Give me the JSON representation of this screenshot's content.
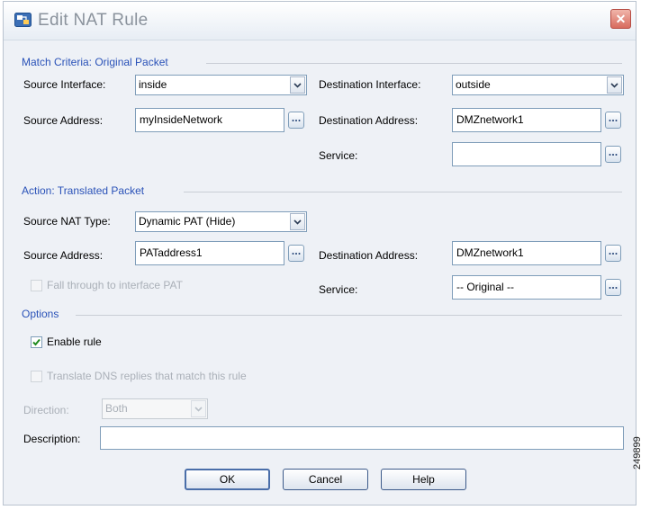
{
  "window": {
    "title": "Edit NAT Rule"
  },
  "match_section": {
    "title": "Match Criteria: Original Packet",
    "source_interface_label": "Source Interface:",
    "source_interface_value": "inside",
    "destination_interface_label": "Destination Interface:",
    "destination_interface_value": "outside",
    "source_address_label": "Source Address:",
    "source_address_value": "myInsideNetwork",
    "destination_address_label": "Destination Address:",
    "destination_address_value": "DMZnetwork1",
    "service_label": "Service:",
    "service_value": ""
  },
  "action_section": {
    "title": "Action: Translated Packet",
    "nat_type_label": "Source NAT Type:",
    "nat_type_value": "Dynamic PAT (Hide)",
    "source_address_label": "Source Address:",
    "source_address_value": "PATaddress1",
    "destination_address_label": "Destination Address:",
    "destination_address_value": "DMZnetwork1",
    "fall_through_label": "Fall through to interface PAT",
    "service_label": "Service:",
    "service_value": "-- Original --"
  },
  "options_section": {
    "title": "Options",
    "enable_rule_label": "Enable rule",
    "enable_rule_checked": true,
    "translate_dns_label": "Translate DNS replies that match this rule",
    "direction_label": "Direction:",
    "direction_value": "Both",
    "description_label": "Description:",
    "description_value": ""
  },
  "buttons": {
    "ok": "OK",
    "cancel": "Cancel",
    "help": "Help"
  },
  "figure_id": "249899",
  "icons": {
    "app": "app-icon",
    "close": "close-icon",
    "dropdown": "chevron-down-icon",
    "browse": "ellipsis-icon",
    "check": "check-icon"
  },
  "colors": {
    "section_title": "#2a52b8",
    "disabled_text": "#aab0b8",
    "close_button": "#d86b5e"
  }
}
